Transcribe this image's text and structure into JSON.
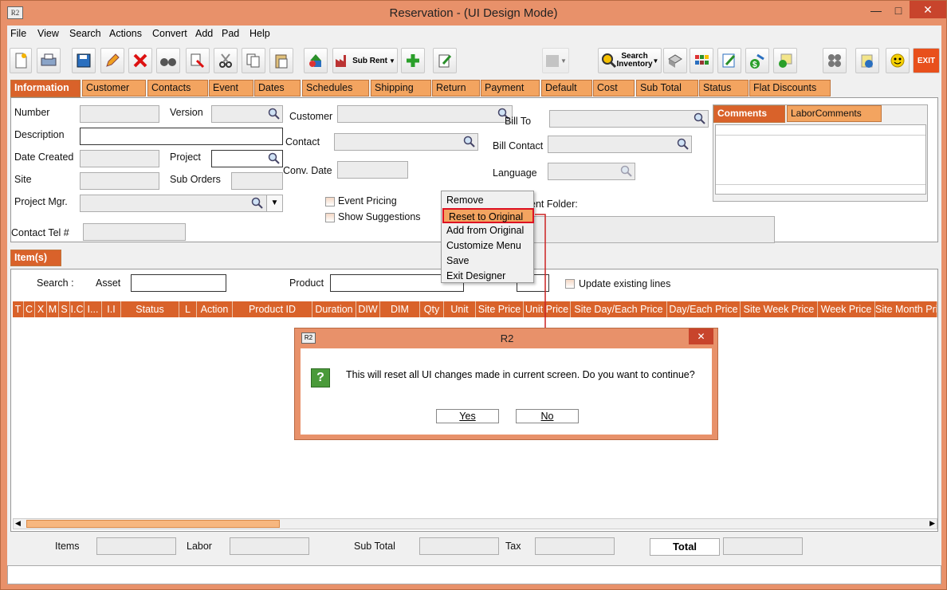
{
  "window": {
    "title": "Reservation - (UI Design Mode)",
    "app_icon": "R2",
    "minimize": "—",
    "maximize": "□",
    "close": "✕"
  },
  "menu": [
    "File",
    "View",
    "Search",
    "Actions",
    "Convert",
    "Add",
    "Pad",
    "Help"
  ],
  "toolbar": {
    "sub_rent": "Sub Rent",
    "search_inventory_1": "Search",
    "search_inventory_2": "Inventory",
    "exit": "EXIT"
  },
  "tabs": [
    "Information",
    "Customer",
    "Contacts",
    "Event",
    "Dates",
    "Schedules",
    "Shipping",
    "Return",
    "Payment",
    "Default",
    "Cost",
    "Sub Total",
    "Status",
    "Flat Discounts"
  ],
  "form": {
    "number": "Number",
    "version": "Version",
    "description": "Description",
    "date_created": "Date Created",
    "project": "Project",
    "site": "Site",
    "sub_orders": "Sub Orders",
    "project_mgr": "Project Mgr.",
    "contact_tel": "Contact Tel #",
    "customer": "Customer",
    "contact": "Contact",
    "conv_date": "Conv. Date",
    "event_pricing": "Event Pricing",
    "show_suggestions": "Show Suggestions",
    "bill_to": "Bill To",
    "bill_contact": "Bill Contact",
    "language": "Language",
    "folder": "ent Folder:"
  },
  "comments_tabs": [
    "Comments",
    "LaborComments"
  ],
  "items_tab": "Item(s)",
  "search_row": {
    "search": "Search :",
    "asset": "Asset",
    "product": "Product",
    "update": "Update existing lines"
  },
  "grid_headers": [
    "T",
    "C",
    "X",
    "M",
    "S",
    "I.C",
    "I...",
    "I.I",
    "Status",
    "L",
    "Action",
    "Product ID",
    "Duration",
    "DIW",
    "DIM",
    "Qty",
    "Unit",
    "Site Price",
    "Unit Price",
    "Site Day/Each Price",
    "Day/Each Price",
    "Site Week Price",
    "Week Price",
    "Site Month Pri"
  ],
  "totals": {
    "items": "Items",
    "labor": "Labor",
    "sub_total": "Sub Total",
    "tax": "Tax",
    "total": "Total"
  },
  "context_menu": [
    "Remove",
    "Reset to Original",
    "Add from Original",
    "Customize Menu",
    "Save",
    "Exit Designer"
  ],
  "dialog": {
    "title": "R2",
    "icon": "R2",
    "close": "✕",
    "message": "This will reset all UI changes made in current screen. Do you want to continue?",
    "yes": "Yes",
    "no": "No",
    "q": "?"
  }
}
